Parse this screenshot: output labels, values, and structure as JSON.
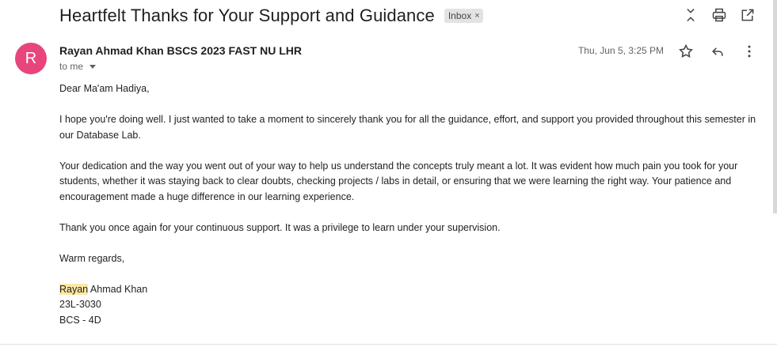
{
  "email": {
    "subject": "Heartfelt Thanks for Your Support and Guidance",
    "label": "Inbox",
    "label_remove": "×",
    "avatar_letter": "R",
    "sender": "Rayan Ahmad Khan BSCS 2023 FAST NU LHR",
    "to": "to me",
    "date": "Thu, Jun 5, 3:25 PM",
    "avatar_color": "#e8457d"
  },
  "body": {
    "greeting": "Dear Ma'am Hadiya,",
    "p1": "I hope you're doing well. I just wanted to take a moment to sincerely thank you for all the guidance, effort, and support you provided throughout this semester in our Database Lab.",
    "p2": "Your dedication and the way you went out of your way to help us understand the concepts truly meant a lot. It was evident how much pain you took for your students, whether it was staying back to clear doubts, checking projects / labs in detail, or ensuring that we were learning the right way. Your patience and encouragement made a huge difference in our learning experience.",
    "p3": "Thank you once again for your continuous support. It was a privilege to learn under your supervision.",
    "closing": "Warm regards,",
    "sig_first": "Rayan",
    "sig_rest": " Ahmad Khan",
    "sig_id": "23L-3030",
    "sig_class": "BCS - 4D"
  },
  "icons": {
    "collapse": "collapse-all-icon",
    "print": "print-icon",
    "open_new": "open-in-new-window-icon",
    "star": "star-icon",
    "reply": "reply-icon",
    "more": "more-vert-icon"
  }
}
